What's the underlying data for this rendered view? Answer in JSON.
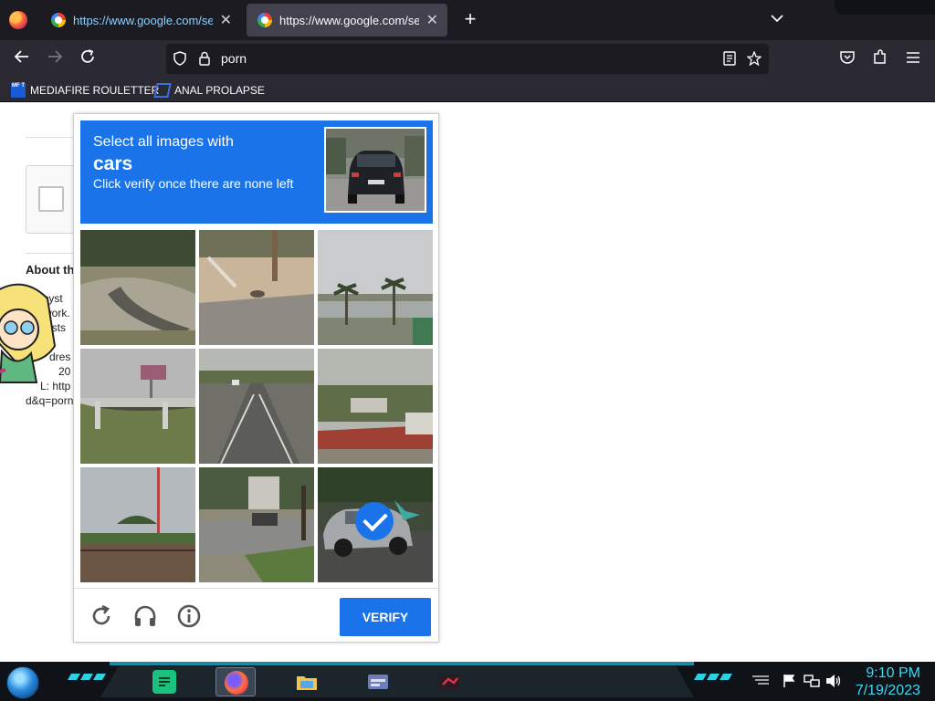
{
  "browser": {
    "tabs": [
      {
        "title": "https://www.google.com/search?q=porn",
        "active": false
      },
      {
        "title": "https://www.google.com/search?q=porn",
        "active": true
      }
    ],
    "url": "porn",
    "bookmarks": [
      {
        "label": "MEDIAFIRE ROULETTER",
        "icon": "mediafire-icon",
        "icon_text": "MF T"
      },
      {
        "label": "ANAL PROLAPSE",
        "icon": "sigma-icon"
      }
    ]
  },
  "background_page": {
    "heading": "About th",
    "lines": [
      "r syst",
      "work.",
      "ests",
      "dres",
      "20",
      "L: http",
      "d&q=porn"
    ]
  },
  "captcha": {
    "instruction": "Select all images with",
    "target": "cars",
    "subtext": "Click verify once there are none left",
    "tiles": [
      {
        "label": "stone-wall-road",
        "selected": false
      },
      {
        "label": "sidewalk-pole",
        "selected": false
      },
      {
        "label": "palm-trees-sea",
        "selected": false
      },
      {
        "label": "overpass-bridge",
        "selected": false
      },
      {
        "label": "highway-lanes",
        "selected": false
      },
      {
        "label": "flowers-hedge",
        "selected": false
      },
      {
        "label": "palm-tree-wall",
        "selected": false
      },
      {
        "label": "street-trees",
        "selected": false
      },
      {
        "label": "silver-car",
        "selected": true
      }
    ],
    "verify_label": "VERIFY",
    "accent": "#1a73e8"
  },
  "taskbar": {
    "time": "9:10 PM",
    "date": "7/19/2023",
    "accent": "#3fd6f0"
  }
}
